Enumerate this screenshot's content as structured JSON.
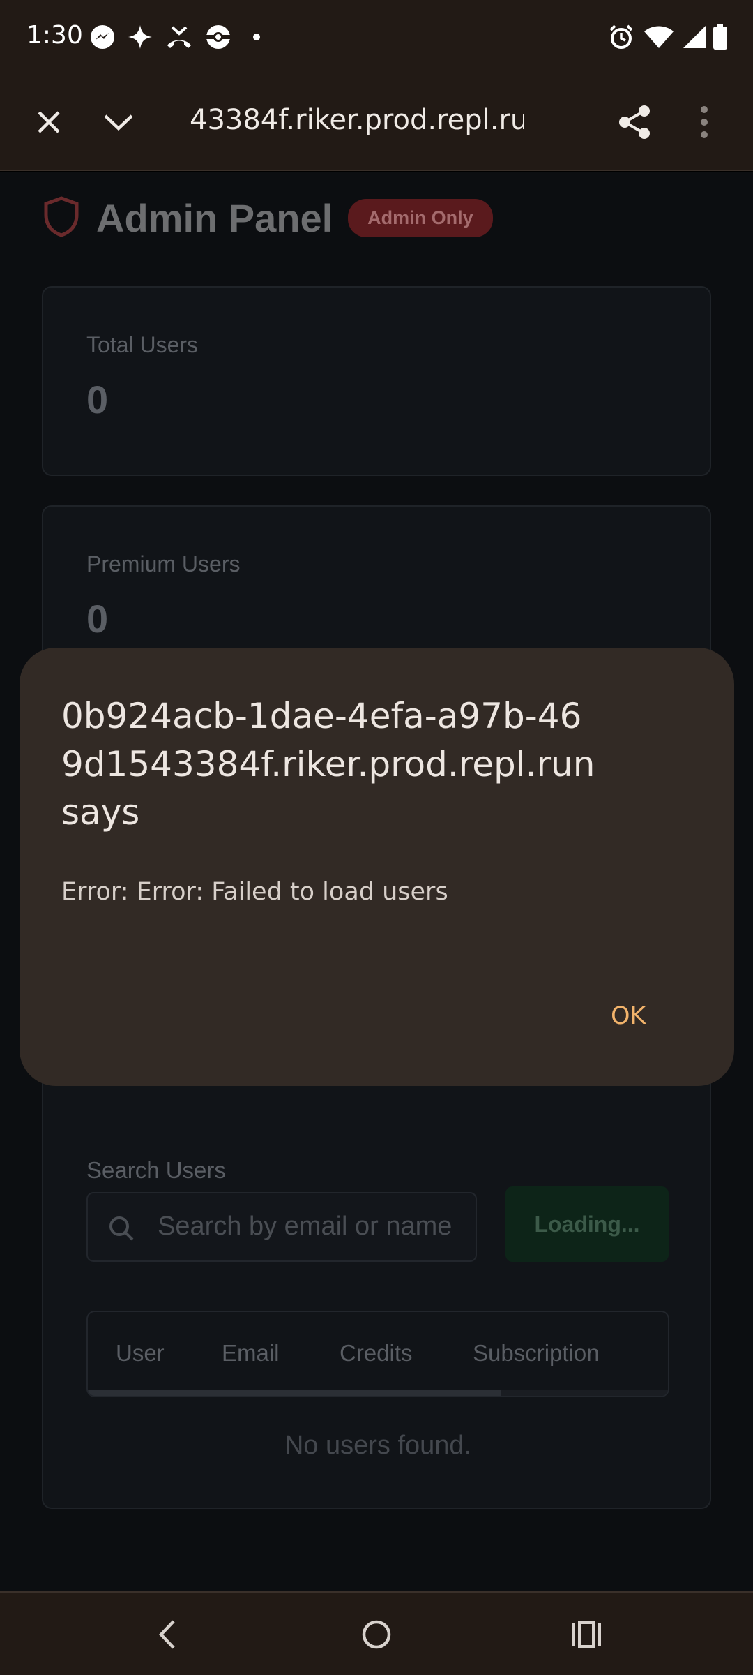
{
  "status_bar": {
    "time": "1:30",
    "left_icons": [
      "messenger-icon",
      "sparkle-icon",
      "missed-call-icon",
      "pokeball-icon",
      "dot-icon"
    ],
    "right_icons": [
      "alarm-icon",
      "wifi-icon",
      "signal-icon",
      "battery-icon"
    ]
  },
  "browser": {
    "url": "0b924acb-1dae-4efa-a97b-469d1543384f.riker.prod.repl.run",
    "url_visible": "43384f.riker.prod.repl.run",
    "close_icon": "close-icon",
    "dropdown_icon": "chevron-down-icon",
    "share_icon": "share-icon",
    "menu_icon": "more-vert-icon"
  },
  "page": {
    "title": "Admin Panel",
    "badge": "Admin Only",
    "stats": [
      {
        "label": "Total Users",
        "value": "0"
      },
      {
        "label": "Premium Users",
        "value": "0"
      }
    ],
    "search": {
      "label": "Search Users",
      "placeholder": "Search by email or name",
      "button": "Loading..."
    },
    "table": {
      "columns": [
        "User",
        "Email",
        "Credits",
        "Subscription"
      ],
      "empty": "No users found."
    }
  },
  "dialog": {
    "title": "0b924acb-1dae-4efa-a97b-46 9d1543384f.riker.prod.repl.run says",
    "title_lines": [
      "0b924acb-1dae-4efa-a97b-46",
      "9d1543384f.riker.prod.repl.run",
      "says"
    ],
    "message": "Error: Error: Failed to load users",
    "ok": "OK"
  },
  "nav": {
    "back": "back-icon",
    "home": "home-icon",
    "recents": "recents-icon"
  },
  "colors": {
    "chrome_bg": "#221a15",
    "dialog_bg": "#322a25",
    "accent": "#f2b36b",
    "badge_bg": "#5a1a1d"
  }
}
